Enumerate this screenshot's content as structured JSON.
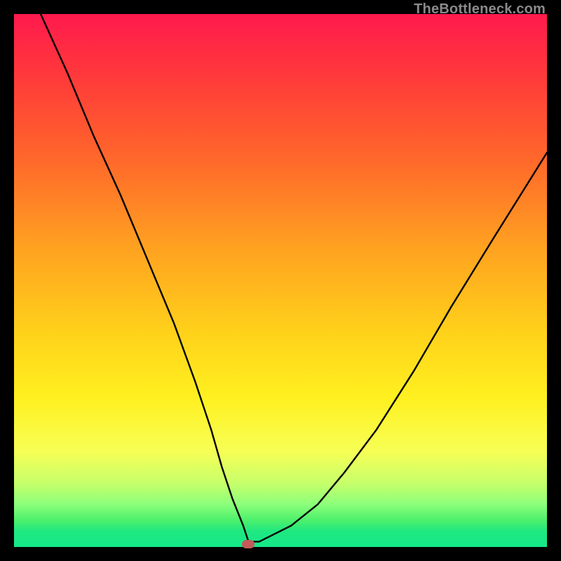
{
  "watermark": "TheBottleneck.com",
  "chart_data": {
    "type": "line",
    "title": "",
    "xlabel": "",
    "ylabel": "",
    "xlim": [
      0,
      100
    ],
    "ylim": [
      0,
      100
    ],
    "grid": false,
    "series": [
      {
        "name": "bottleneck-curve",
        "x": [
          5,
          10,
          15,
          20,
          25,
          30,
          34,
          37,
          39,
          41,
          43,
          44,
          46,
          48,
          52,
          57,
          62,
          68,
          75,
          82,
          90,
          100
        ],
        "y": [
          100,
          89,
          77,
          66,
          54,
          42,
          31,
          22,
          15,
          9,
          4,
          1,
          1,
          2,
          4,
          8,
          14,
          22,
          33,
          45,
          58,
          74
        ]
      }
    ],
    "annotations": [
      {
        "name": "min-marker",
        "x": 44,
        "y": 0.5
      }
    ],
    "background_gradient": {
      "top": "#ff1a4d",
      "bottom": "#14e88a"
    }
  }
}
